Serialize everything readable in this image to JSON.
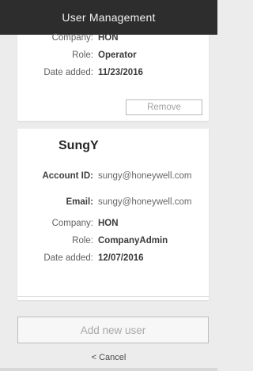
{
  "header": {
    "title": "User Management"
  },
  "users": [
    {
      "company_label": "Company:",
      "company": "HON",
      "role_label": "Role:",
      "role": "Operator",
      "date_label": "Date added:",
      "date": "11/23/2016",
      "remove_label": "Remove"
    },
    {
      "name": "SungY",
      "account_label": "Account ID:",
      "account": "sungy@honeywell.com",
      "email_label": "Email:",
      "email": "sungy@honeywell.com",
      "company_label": "Company:",
      "company": "HON",
      "role_label": "Role:",
      "role": "CompanyAdmin",
      "date_label": "Date added:",
      "date": "12/07/2016"
    }
  ],
  "actions": {
    "add_label": "Add new user",
    "cancel_label": "< Cancel"
  }
}
